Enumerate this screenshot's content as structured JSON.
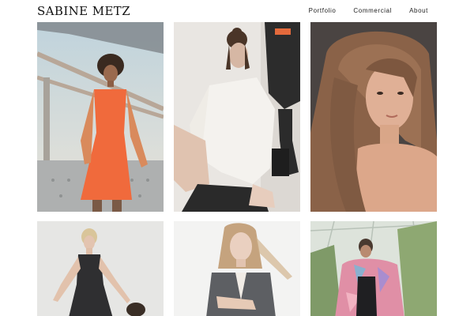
{
  "header": {
    "brand": "SABINE METZ",
    "nav": [
      {
        "label": "Portfolio"
      },
      {
        "label": "Commercial"
      },
      {
        "label": "About"
      }
    ]
  },
  "gallery": {
    "tiles": [
      {
        "subject": "model in orange dress on bridge"
      },
      {
        "subject": "model in white jacket seated"
      },
      {
        "subject": "close-up portrait long hair"
      },
      {
        "subject": "model in dark dress"
      },
      {
        "subject": "model in grey blazer"
      },
      {
        "subject": "model in feathered coat in greenhouse"
      }
    ]
  }
}
